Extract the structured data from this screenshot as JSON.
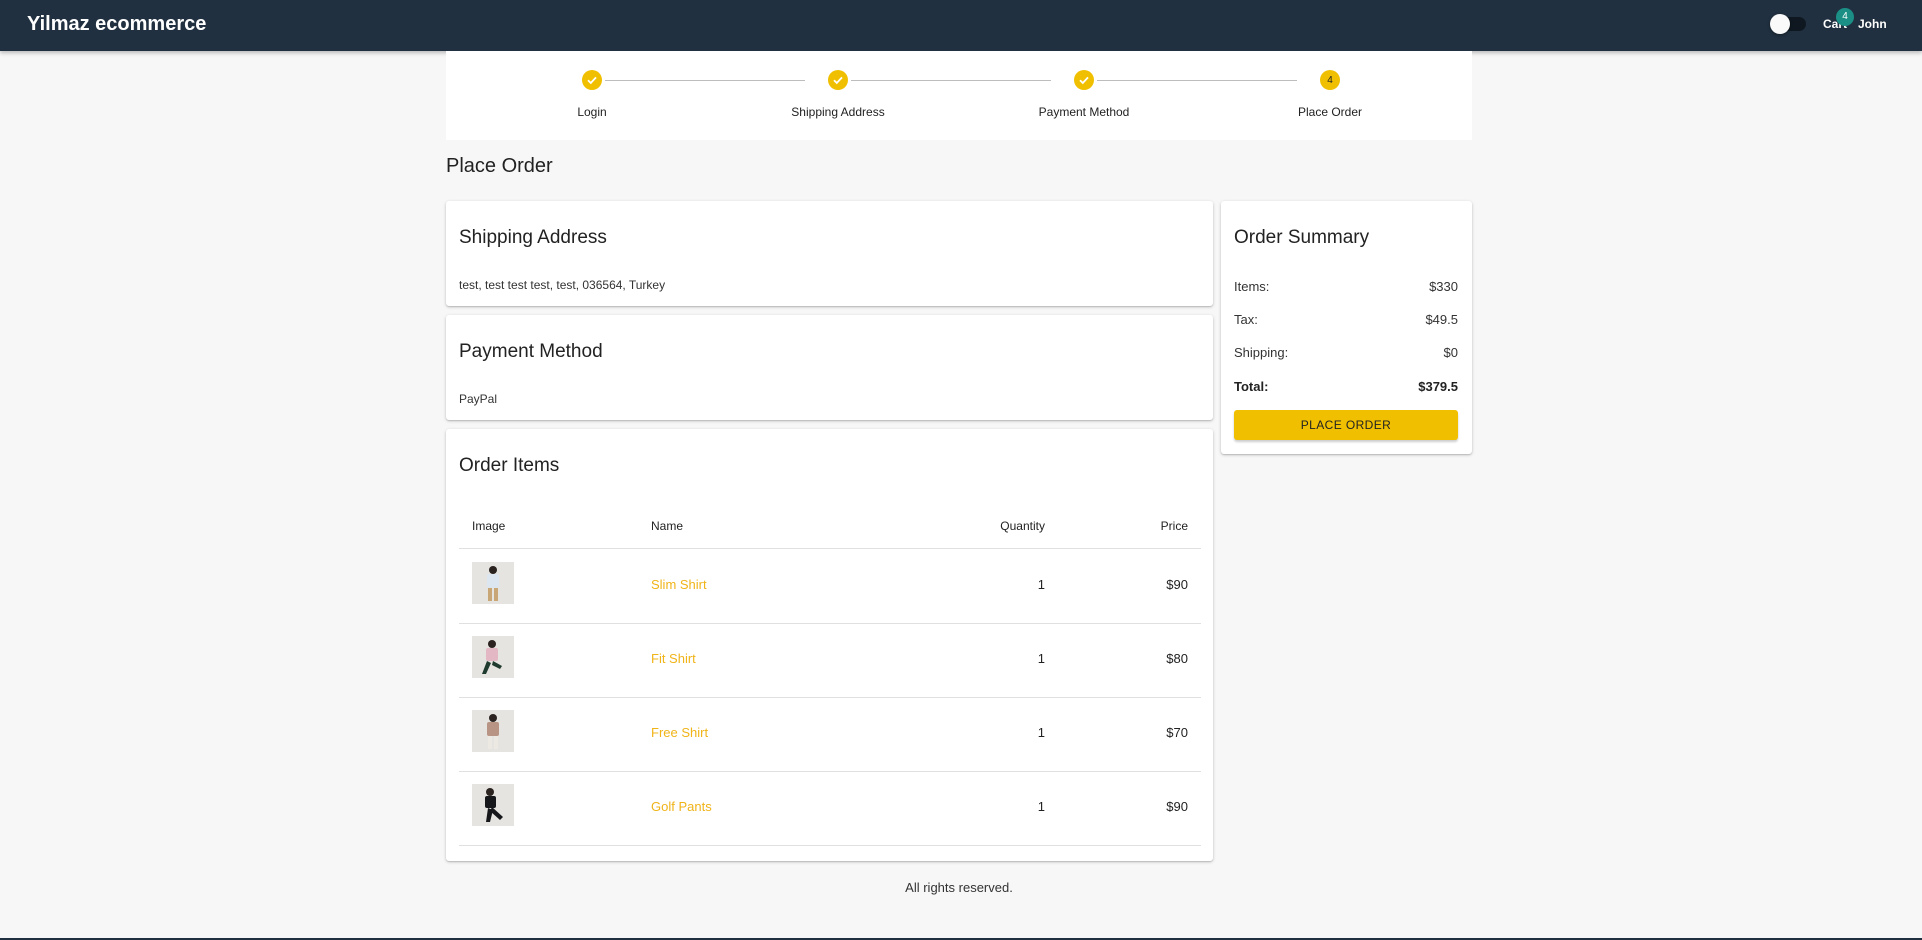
{
  "header": {
    "brand": "Yilmaz ecommerce",
    "cart_label": "Cart",
    "cart_count": "4",
    "user_label": "John"
  },
  "stepper": {
    "steps": [
      {
        "label": "Login",
        "state": "completed"
      },
      {
        "label": "Shipping Address",
        "state": "completed"
      },
      {
        "label": "Payment Method",
        "state": "completed"
      },
      {
        "label": "Place Order",
        "state": "active",
        "number": "4"
      }
    ]
  },
  "page": {
    "title": "Place Order"
  },
  "shipping": {
    "title": "Shipping Address",
    "address": "test, test test test, test, 036564, Turkey"
  },
  "payment": {
    "title": "Payment Method",
    "method": "PayPal"
  },
  "order_items": {
    "title": "Order Items",
    "columns": {
      "image": "Image",
      "name": "Name",
      "quantity": "Quantity",
      "price": "Price"
    },
    "rows": [
      {
        "name": "Slim Shirt",
        "quantity": "1",
        "price": "$90",
        "image_icon": "product-photo-icon"
      },
      {
        "name": "Fit Shirt",
        "quantity": "1",
        "price": "$80",
        "image_icon": "product-photo-icon"
      },
      {
        "name": "Free Shirt",
        "quantity": "1",
        "price": "$70",
        "image_icon": "product-photo-icon"
      },
      {
        "name": "Golf Pants",
        "quantity": "1",
        "price": "$90",
        "image_icon": "product-photo-icon"
      }
    ]
  },
  "summary": {
    "title": "Order Summary",
    "items_label": "Items:",
    "items_value": "$330",
    "tax_label": "Tax:",
    "tax_value": "$49.5",
    "shipping_label": "Shipping:",
    "shipping_value": "$0",
    "total_label": "Total:",
    "total_value": "$379.5",
    "button_label": "PLACE ORDER"
  },
  "footer": {
    "text": "All rights reserved."
  },
  "colors": {
    "appbar": "#203040",
    "accent": "#f0c000",
    "link": "#f0b419",
    "badge": "#1b8f86",
    "background": "#f7f7f7"
  }
}
